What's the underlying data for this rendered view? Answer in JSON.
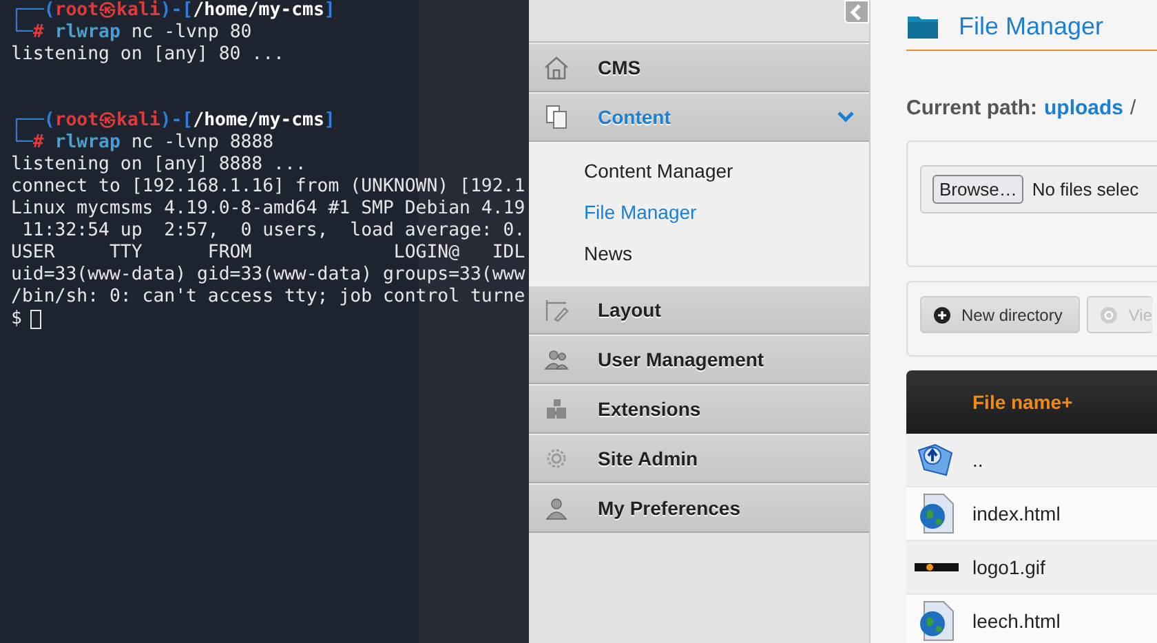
{
  "terminal": {
    "lines": [
      {
        "kind": "prompt",
        "segments": [
          {
            "text": "┌──(",
            "color": "#2f7fe0"
          },
          {
            "text": "root㉿kali",
            "color": "#e03a3a"
          },
          {
            "text": ")-[",
            "color": "#2f7fe0"
          },
          {
            "text": "/home/my-cms",
            "color": "#ffffff"
          },
          {
            "text": "]",
            "color": "#2f7fe0"
          }
        ]
      },
      {
        "kind": "prompt",
        "segments": [
          {
            "text": "└─",
            "color": "#2f7fe0"
          },
          {
            "text": "#",
            "color": "#e03a3a"
          },
          {
            "text": " rlwrap",
            "color": "#4a9fd0"
          },
          {
            "text": " nc -lvnp 80",
            "color": "#e6e6e6"
          }
        ]
      },
      {
        "kind": "output",
        "text": "listening on [any] 80 ..."
      },
      {
        "kind": "blank"
      },
      {
        "kind": "blank"
      },
      {
        "kind": "prompt",
        "segments": [
          {
            "text": "┌──(",
            "color": "#2f7fe0"
          },
          {
            "text": "root㉿kali",
            "color": "#e03a3a"
          },
          {
            "text": ")-[",
            "color": "#2f7fe0"
          },
          {
            "text": "/home/my-cms",
            "color": "#ffffff"
          },
          {
            "text": "]",
            "color": "#2f7fe0"
          }
        ]
      },
      {
        "kind": "prompt",
        "segments": [
          {
            "text": "└─",
            "color": "#2f7fe0"
          },
          {
            "text": "#",
            "color": "#e03a3a"
          },
          {
            "text": " rlwrap",
            "color": "#4a9fd0"
          },
          {
            "text": " nc -lvnp 8888",
            "color": "#e6e6e6"
          }
        ]
      },
      {
        "kind": "output",
        "text": "listening on [any] 8888 ..."
      },
      {
        "kind": "output",
        "text": "connect to [192.168.1.16] from (UNKNOWN) [192.1"
      },
      {
        "kind": "output",
        "text": "Linux mycmsms 4.19.0-8-amd64 #1 SMP Debian 4.19"
      },
      {
        "kind": "output",
        "text": " 11:32:54 up  2:57,  0 users,  load average: 0."
      },
      {
        "kind": "output",
        "text": "USER     TTY      FROM             LOGIN@   IDL"
      },
      {
        "kind": "output",
        "text": "uid=33(www-data) gid=33(www-data) groups=33(www"
      },
      {
        "kind": "output",
        "text": "/bin/sh: 0: can't access tty; job control turne"
      },
      {
        "kind": "cursor",
        "text": "$"
      }
    ]
  },
  "sidebar": {
    "sections": [
      {
        "label": "CMS",
        "kind": "home",
        "expanded": false
      },
      {
        "label": "Content",
        "kind": "pages",
        "expanded": true,
        "children": [
          {
            "label": "Content Manager",
            "selected": false
          },
          {
            "label": "File Manager",
            "selected": true
          },
          {
            "label": "News",
            "selected": false
          }
        ]
      },
      {
        "label": "Layout",
        "kind": "layout",
        "expanded": false
      },
      {
        "label": "User Management",
        "kind": "users",
        "expanded": false
      },
      {
        "label": "Extensions",
        "kind": "extensions",
        "expanded": false
      },
      {
        "label": "Site Admin",
        "kind": "admin",
        "expanded": false
      },
      {
        "label": "My Preferences",
        "kind": "preferences",
        "expanded": false
      }
    ]
  },
  "main": {
    "title": "File Manager",
    "path_label": "Current path:",
    "path_link": "uploads",
    "path_separator": "/",
    "upload": {
      "button": "Browse…",
      "status": "No files selec"
    },
    "toolbar": [
      {
        "label": "New directory",
        "disabled": false
      },
      {
        "label": "Vie",
        "disabled": true
      }
    ],
    "table": {
      "column": "File name+",
      "rows": [
        {
          "kind": "parent",
          "name": ".."
        },
        {
          "kind": "html",
          "name": "index.html"
        },
        {
          "kind": "image",
          "name": "logo1.gif"
        },
        {
          "kind": "html",
          "name": "leech.html"
        }
      ]
    }
  }
}
